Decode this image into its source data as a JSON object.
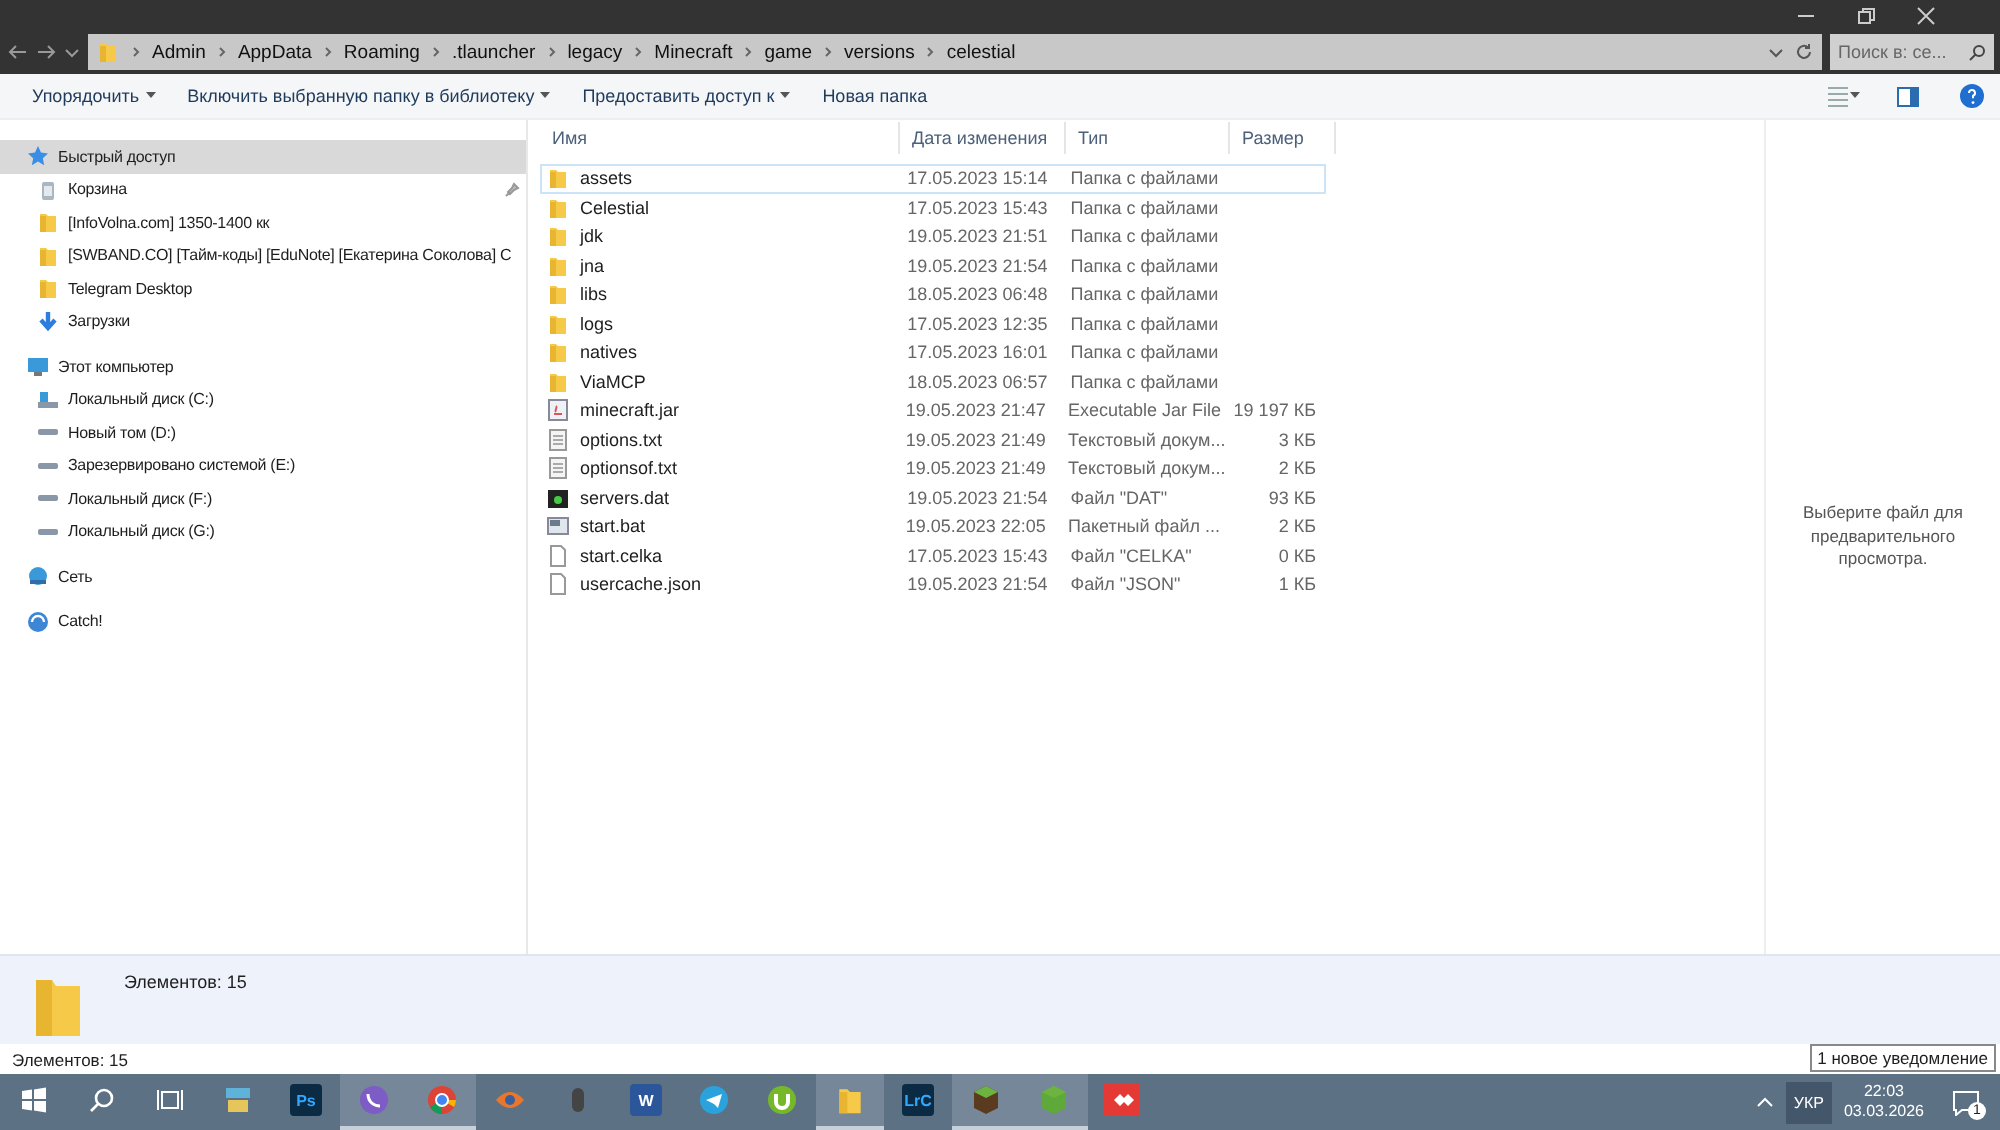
{
  "address": {
    "crumbs": [
      "Admin",
      "AppData",
      "Roaming",
      ".tlauncher",
      "legacy",
      "Minecraft",
      "game",
      "versions",
      "celestial"
    ],
    "search_placeholder": "Поиск в: се..."
  },
  "toolbar": [
    {
      "label": "Упорядочить",
      "dropdown": true
    },
    {
      "label": "Включить выбранную папку в библиотеку",
      "dropdown": true
    },
    {
      "label": "Предоставить доступ к",
      "dropdown": true
    },
    {
      "label": "Новая папка",
      "dropdown": false
    }
  ],
  "sidebar": [
    {
      "kind": "star",
      "label": "Быстрый доступ",
      "header": true,
      "selected": true
    },
    {
      "kind": "recycle",
      "label": "Корзина",
      "header": false,
      "selected": false,
      "pinned": true
    },
    {
      "kind": "folder",
      "label": "[InfoVolna.com] 1350-1400 кк",
      "header": false,
      "selected": false,
      "pinned": false
    },
    {
      "kind": "folder",
      "label": "[SWBAND.CO] [Тайм-коды] [EduNote] [Екатерина Соколова] C",
      "header": false,
      "selected": false,
      "pinned": false
    },
    {
      "kind": "folder",
      "label": "Telegram Desktop",
      "header": false,
      "selected": false,
      "pinned": false
    },
    {
      "kind": "download",
      "label": "Загрузки",
      "header": false,
      "selected": false,
      "pinned": false
    },
    {
      "kind": "computer",
      "label": "Этот компьютер",
      "header": true,
      "selected": false
    },
    {
      "kind": "system-drive",
      "label": "Локальный диск (C:)",
      "header": false,
      "selected": false,
      "pinned": false
    },
    {
      "kind": "drive",
      "label": "Новый том (D:)",
      "header": false,
      "selected": false,
      "pinned": false
    },
    {
      "kind": "drive",
      "label": "Зарезервировано системой (E:)",
      "header": false,
      "selected": false,
      "pinned": false
    },
    {
      "kind": "drive",
      "label": "Локальный диск (F:)",
      "header": false,
      "selected": false,
      "pinned": false
    },
    {
      "kind": "drive",
      "label": "Локальный диск (G:)",
      "header": false,
      "selected": false,
      "pinned": false
    },
    {
      "kind": "network",
      "label": "Сеть",
      "header": true,
      "selected": false
    },
    {
      "kind": "catch",
      "label": "Catch!",
      "header": true,
      "selected": false
    }
  ],
  "table": {
    "columns": [
      "Имя",
      "Дата изменения",
      "Тип",
      "Размер"
    ],
    "rows": [
      {
        "kind": "folder",
        "name": "assets",
        "date": "17.05.2023 15:14",
        "type": "Папка с файлами",
        "selected": true
      },
      {
        "kind": "folder",
        "name": "Celestial",
        "date": "17.05.2023 15:43",
        "type": "Папка с файлами",
        "selected": false
      },
      {
        "kind": "folder",
        "name": "jdk",
        "date": "19.05.2023 21:51",
        "type": "Папка с файлами",
        "selected": false
      },
      {
        "kind": "folder",
        "name": "jna",
        "date": "19.05.2023 21:54",
        "type": "Папка с файлами",
        "selected": false
      },
      {
        "kind": "folder",
        "name": "libs",
        "date": "18.05.2023 06:48",
        "type": "Папка с файлами",
        "selected": false
      },
      {
        "kind": "folder",
        "name": "logs",
        "date": "17.05.2023 12:35",
        "type": "Папка с файлами",
        "selected": false
      },
      {
        "kind": "folder",
        "name": "natives",
        "date": "17.05.2023 16:01",
        "type": "Папка с файлами",
        "selected": false
      },
      {
        "kind": "folder",
        "name": "ViaMCP",
        "date": "18.05.2023 06:57",
        "type": "Папка с файлами",
        "selected": false
      },
      {
        "kind": "jar",
        "name": "minecraft.jar",
        "date": "19.05.2023 21:47",
        "type": "Executable Jar File",
        "size": "19 197 КБ",
        "selected": false
      },
      {
        "kind": "text",
        "name": "options.txt",
        "date": "19.05.2023 21:49",
        "type": "Текстовый докум...",
        "size": "3 КБ",
        "selected": false
      },
      {
        "kind": "text",
        "name": "optionsof.txt",
        "date": "19.05.2023 21:49",
        "type": "Текстовый докум...",
        "size": "2 КБ",
        "selected": false
      },
      {
        "kind": "dat",
        "name": "servers.dat",
        "date": "19.05.2023 21:54",
        "type": "Файл \"DAT\"",
        "size": "93 КБ",
        "selected": false
      },
      {
        "kind": "bat",
        "name": "start.bat",
        "date": "19.05.2023 22:05",
        "type": "Пакетный файл ...",
        "size": "2 КБ",
        "selected": false
      },
      {
        "kind": "file",
        "name": "start.celka",
        "date": "17.05.2023 15:43",
        "type": "Файл \"CELKA\"",
        "size": "0 КБ",
        "selected": false
      },
      {
        "kind": "file",
        "name": "usercache.json",
        "date": "19.05.2023 21:54",
        "type": "Файл \"JSON\"",
        "size": "1 КБ",
        "selected": false
      }
    ]
  },
  "preview": "Выберите файл для предварительного просмотра.",
  "details": "Элементов: 15",
  "status_bar": "Элементов: 15",
  "tooltip": "1 новое уведомление",
  "taskbar": {
    "apps": [
      {
        "kind": "start",
        "active": false
      },
      {
        "kind": "search",
        "active": false
      },
      {
        "kind": "taskview",
        "active": false
      },
      {
        "kind": "stack",
        "active": false
      },
      {
        "kind": "label",
        "label": "Ps",
        "color": "#0b2a44",
        "active": false
      },
      {
        "kind": "viber",
        "active": true
      },
      {
        "kind": "chrome",
        "active": true
      },
      {
        "kind": "eye",
        "active": false
      },
      {
        "kind": "mouse",
        "active": false
      },
      {
        "kind": "label",
        "label": "W",
        "color": "#2b579a",
        "active": false
      },
      {
        "kind": "telegram",
        "active": false
      },
      {
        "kind": "torrent",
        "active": false
      },
      {
        "kind": "folder",
        "active": true
      },
      {
        "kind": "label",
        "label": "LrC",
        "color": "#0b2a44",
        "active": false
      },
      {
        "kind": "block",
        "color": "#5a3b20",
        "active": true
      },
      {
        "kind": "block",
        "color": "#5fa83a",
        "active": true
      },
      {
        "kind": "remote",
        "active": false
      }
    ],
    "language": "УКР",
    "time": "22:03",
    "date": "03.03.2026",
    "notifications": "1"
  }
}
